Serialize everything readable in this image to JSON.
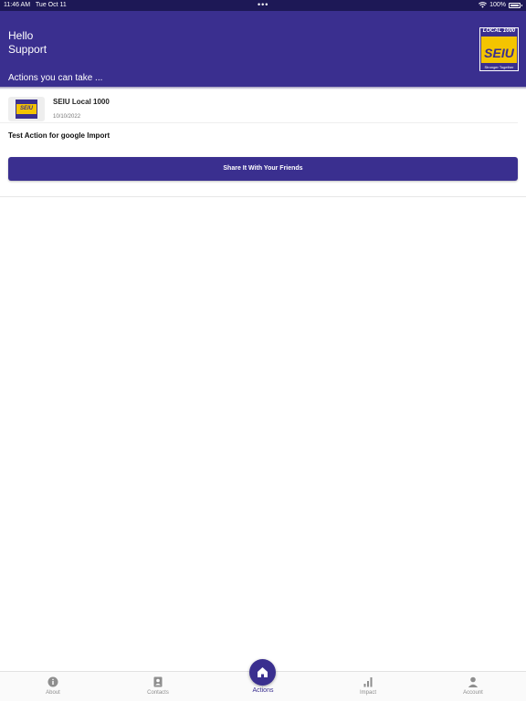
{
  "status_bar": {
    "time": "11:46 AM",
    "date": "Tue Oct 11",
    "dots": "•••",
    "battery": "100%"
  },
  "header": {
    "greeting_line1": "Hello",
    "greeting_line2": "Support",
    "subtitle": "Actions you can take ...",
    "logo": {
      "top": "LOCAL 1000",
      "main": "SEIU",
      "tagline": "Stronger Together"
    }
  },
  "action_card": {
    "organization": "SEIU Local 1000",
    "date": "10/10/2022",
    "title": "Test Action for google Import",
    "share_button": "Share It With Your Friends",
    "avatar_text": "SEIU"
  },
  "tabbar": {
    "tabs": [
      {
        "label": "About",
        "icon": "info-icon"
      },
      {
        "label": "Contacts",
        "icon": "contacts-icon"
      },
      {
        "label": "Actions",
        "icon": "home-icon"
      },
      {
        "label": "Impact",
        "icon": "bar-chart-icon"
      },
      {
        "label": "Account",
        "icon": "person-icon"
      }
    ],
    "active": "Actions"
  },
  "colors": {
    "brand_purple": "#3a2f8f",
    "status_bar": "#1d1856",
    "brand_yellow": "#f4c400"
  }
}
